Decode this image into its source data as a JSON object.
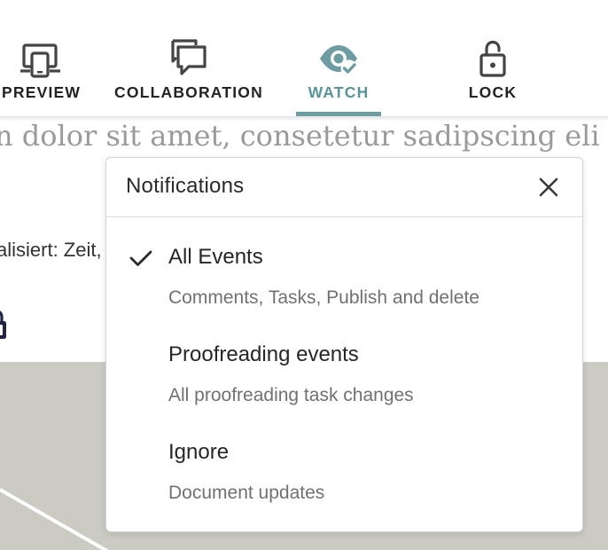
{
  "toolbar": {
    "tools": [
      {
        "label": "PREVIEW",
        "icon": "preview-devices-icon",
        "active": false
      },
      {
        "label": "COLLABORATION",
        "icon": "chat-bubbles-icon",
        "active": false
      },
      {
        "label": "WATCH",
        "icon": "eye-check-icon",
        "active": true
      },
      {
        "label": "LOCK",
        "icon": "unlocked-padlock-icon",
        "active": false
      }
    ],
    "active_color": "#5b939a"
  },
  "document": {
    "text_line": "n dolor sit amet, consetetur sadipscing eli",
    "meta_line": "alisiert: Zeit,"
  },
  "notifications": {
    "title": "Notifications",
    "close_icon": "close-icon",
    "options": [
      {
        "title": "All Events",
        "description": "Comments, Tasks, Publish and delete",
        "selected": true
      },
      {
        "title": "Proofreading events",
        "description": "All proofreading task changes",
        "selected": false
      },
      {
        "title": "Ignore",
        "description": "Document updates",
        "selected": false
      }
    ]
  },
  "colors": {
    "accent": "#6d9ca2",
    "background_area": "#cbcbc4",
    "text_primary": "#262626",
    "text_secondary": "#717171"
  }
}
